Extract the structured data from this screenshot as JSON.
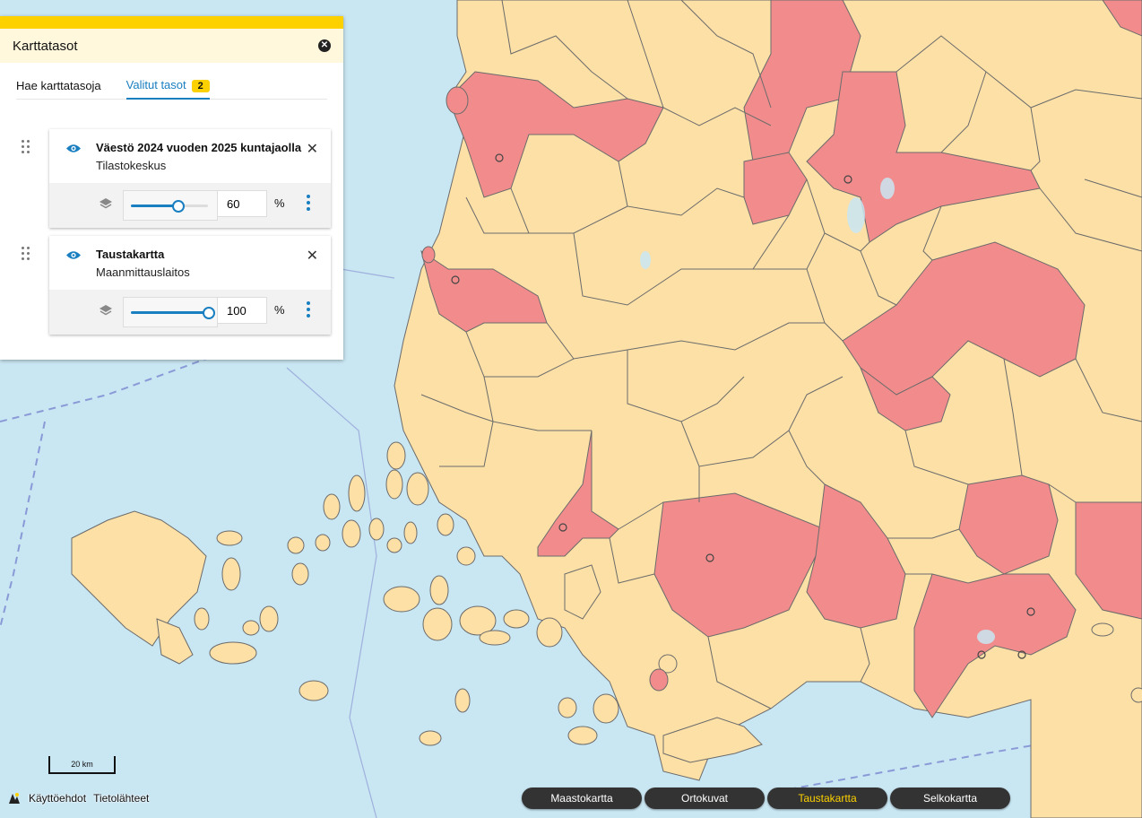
{
  "panel": {
    "title": "Karttatasot",
    "tabs": [
      {
        "label": "Hae karttatasoja"
      },
      {
        "label": "Valitut tasot",
        "count": "2"
      }
    ],
    "layers": [
      {
        "name": "Väestö 2024 vuoden 2025 kuntajaolla",
        "source": "Tilastokeskus",
        "opacity": "60",
        "opacity_fraction": 0.6,
        "unit": "%"
      },
      {
        "name": "Taustakartta",
        "source": "Maanmittauslaitos",
        "opacity": "100",
        "opacity_fraction": 1.0,
        "unit": "%"
      }
    ]
  },
  "map": {
    "scale_label": "20 km"
  },
  "footer": {
    "links": [
      "Käyttöehdot",
      "Tietolähteet"
    ]
  },
  "basemaps": {
    "buttons": [
      "Maastokartta",
      "Ortokuvat",
      "Taustakartta",
      "Selkokartta"
    ],
    "active_index": 2
  },
  "colors": {
    "accent": "#1a7fc1",
    "brand_yellow": "#fdd100",
    "sea": "#c9e6f3",
    "land": "#fde0a6",
    "high_population": "#f28c8c"
  },
  "icons": {
    "close": "close-icon",
    "eye": "eye-icon",
    "remove": "x-icon",
    "layers": "layers-stack-icon",
    "drag": "drag-handle-icon",
    "more": "more-vertical-icon",
    "logo": "app-logo-icon"
  }
}
